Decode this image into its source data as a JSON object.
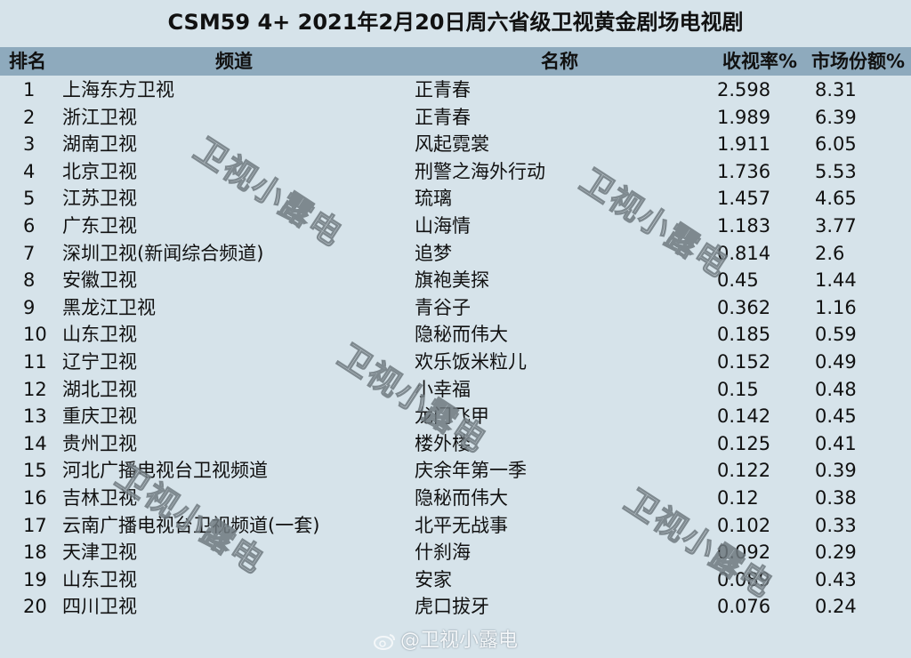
{
  "title": "CSM59 4+ 2021年2月20日周六省级卫视黄金剧场电视剧",
  "headers": {
    "rank": "排名",
    "channel": "频道",
    "name": "名称",
    "rating": "收视率%",
    "share": "市场份额%"
  },
  "rows": [
    {
      "rank": "1",
      "channel": "上海东方卫视",
      "name": "正青春",
      "rating": "2.598",
      "share": "8.31"
    },
    {
      "rank": "2",
      "channel": "浙江卫视",
      "name": "正青春",
      "rating": "1.989",
      "share": "6.39"
    },
    {
      "rank": "3",
      "channel": "湖南卫视",
      "name": "风起霓裳",
      "rating": "1.911",
      "share": "6.05"
    },
    {
      "rank": "4",
      "channel": "北京卫视",
      "name": "刑警之海外行动",
      "rating": "1.736",
      "share": "5.53"
    },
    {
      "rank": "5",
      "channel": "江苏卫视",
      "name": "琉璃",
      "rating": "1.457",
      "share": "4.65"
    },
    {
      "rank": "6",
      "channel": "广东卫视",
      "name": "山海情",
      "rating": "1.183",
      "share": "3.77"
    },
    {
      "rank": "7",
      "channel": "深圳卫视(新闻综合频道)",
      "name": "追梦",
      "rating": "0.814",
      "share": "2.6"
    },
    {
      "rank": "8",
      "channel": "安徽卫视",
      "name": "旗袍美探",
      "rating": "0.45",
      "share": "1.44"
    },
    {
      "rank": "9",
      "channel": "黑龙江卫视",
      "name": "青谷子",
      "rating": "0.362",
      "share": "1.16"
    },
    {
      "rank": "10",
      "channel": "山东卫视",
      "name": "隐秘而伟大",
      "rating": "0.185",
      "share": "0.59"
    },
    {
      "rank": "11",
      "channel": "辽宁卫视",
      "name": "欢乐饭米粒儿",
      "rating": "0.152",
      "share": "0.49"
    },
    {
      "rank": "12",
      "channel": "湖北卫视",
      "name": "小幸福",
      "rating": "0.15",
      "share": "0.48"
    },
    {
      "rank": "13",
      "channel": "重庆卫视",
      "name": "龙门飞甲",
      "rating": "0.142",
      "share": "0.45"
    },
    {
      "rank": "14",
      "channel": "贵州卫视",
      "name": "楼外楼",
      "rating": "0.125",
      "share": "0.41"
    },
    {
      "rank": "15",
      "channel": "河北广播电视台卫视频道",
      "name": "庆余年第一季",
      "rating": "0.122",
      "share": "0.39"
    },
    {
      "rank": "16",
      "channel": "吉林卫视",
      "name": "隐秘而伟大",
      "rating": "0.12",
      "share": "0.38"
    },
    {
      "rank": "17",
      "channel": "云南广播电视台卫视频道(一套)",
      "name": "北平无战事",
      "rating": "0.102",
      "share": "0.33"
    },
    {
      "rank": "18",
      "channel": "天津卫视",
      "name": "什刹海",
      "rating": "0.092",
      "share": "0.29"
    },
    {
      "rank": "19",
      "channel": "山东卫视",
      "name": "安家",
      "rating": "0.089",
      "share": "0.43"
    },
    {
      "rank": "20",
      "channel": "四川卫视",
      "name": "虎口拔牙",
      "rating": "0.076",
      "share": "0.24"
    }
  ],
  "watermark_text": "卫视小露电",
  "footer_watermark": "@卫视小露电",
  "colors": {
    "background": "#d6e3ea",
    "header_bg": "#8eaabd"
  }
}
